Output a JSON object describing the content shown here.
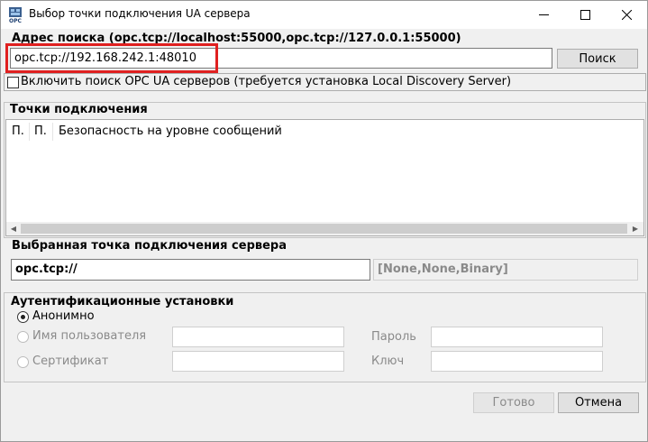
{
  "window": {
    "title": "Выбор точки подключения UA сервера",
    "icon_caption": "OPC",
    "minimize_icon": "minimize-icon",
    "maximize_icon": "maximize-icon",
    "close_icon": "close-icon"
  },
  "search": {
    "label": "Адрес поиска (opc.tcp://localhost:55000,opc.tcp://127.0.0.1:55000)",
    "value": "opc.tcp://192.168.242.1:48010",
    "button_label": "Поиск",
    "highlight_color": "#e02020"
  },
  "discovery": {
    "checkbox_label": "Включить поиск OPC UA серверов (требуется установка Local Discovery Server)",
    "checked": false
  },
  "endpoints": {
    "group_label": "Точки подключения",
    "columns": [
      "П.",
      "П.",
      "Безопасность на уровне сообщений"
    ],
    "rows": []
  },
  "selected": {
    "label": "Выбранная точка подключения сервера",
    "value": "opc.tcp://",
    "security": "[None,None,Binary]"
  },
  "auth": {
    "group_label": "Аутентификационные установки",
    "options": [
      {
        "label": "Анонимно",
        "selected": true,
        "enabled": true
      },
      {
        "label": "Имя пользователя",
        "selected": false,
        "enabled": false
      },
      {
        "label": "Сертификат",
        "selected": false,
        "enabled": false
      }
    ],
    "password_label": "Пароль",
    "key_label": "Ключ"
  },
  "footer": {
    "ok_label": "Готово",
    "cancel_label": "Отмена"
  }
}
